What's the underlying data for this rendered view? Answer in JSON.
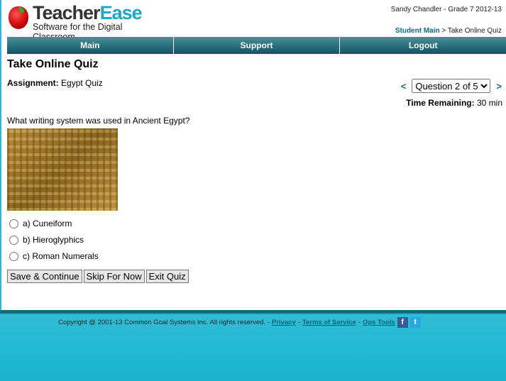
{
  "header": {
    "brand_a": "Teacher",
    "brand_b": "Ease",
    "tagline": "Software for the Digital Classroom",
    "user": "Sandy Chandler - Grade 7 2012-13",
    "breadcrumb": {
      "link": "Student Main",
      "sep": " > ",
      "current": "Take Online Quiz"
    }
  },
  "nav": [
    {
      "label": "Main"
    },
    {
      "label": "Support"
    },
    {
      "label": "Logout"
    }
  ],
  "page_title": "Take Online Quiz",
  "assignment": {
    "label": "Assignment:",
    "value": " Egypt Quiz"
  },
  "question_nav": {
    "prev": "<",
    "next": ">",
    "selected": "Question 2 of 5"
  },
  "time": {
    "label": "Time Remaining:",
    "value": " 30 min"
  },
  "question": "What writing system was used in Ancient Egypt?",
  "options": [
    {
      "label": "a) Cuneiform"
    },
    {
      "label": "b) Hieroglyphics"
    },
    {
      "label": "c) Roman Numerals"
    }
  ],
  "buttons": {
    "save": "Save & Continue",
    "skip": "Skip For Now",
    "exit": "Exit Quiz"
  },
  "footer": {
    "copyright": "Copyright @ 2001-13 Common Goal Systems Inc. All rights reserved. -",
    "privacy": "Privacy",
    "terms": "Terms of Service",
    "ops": "Ops Tools",
    "dash": "-",
    "fb": "f",
    "tw": "t"
  },
  "colors": {
    "accent": "#0e6d86",
    "footer": "#1ab4cf"
  }
}
